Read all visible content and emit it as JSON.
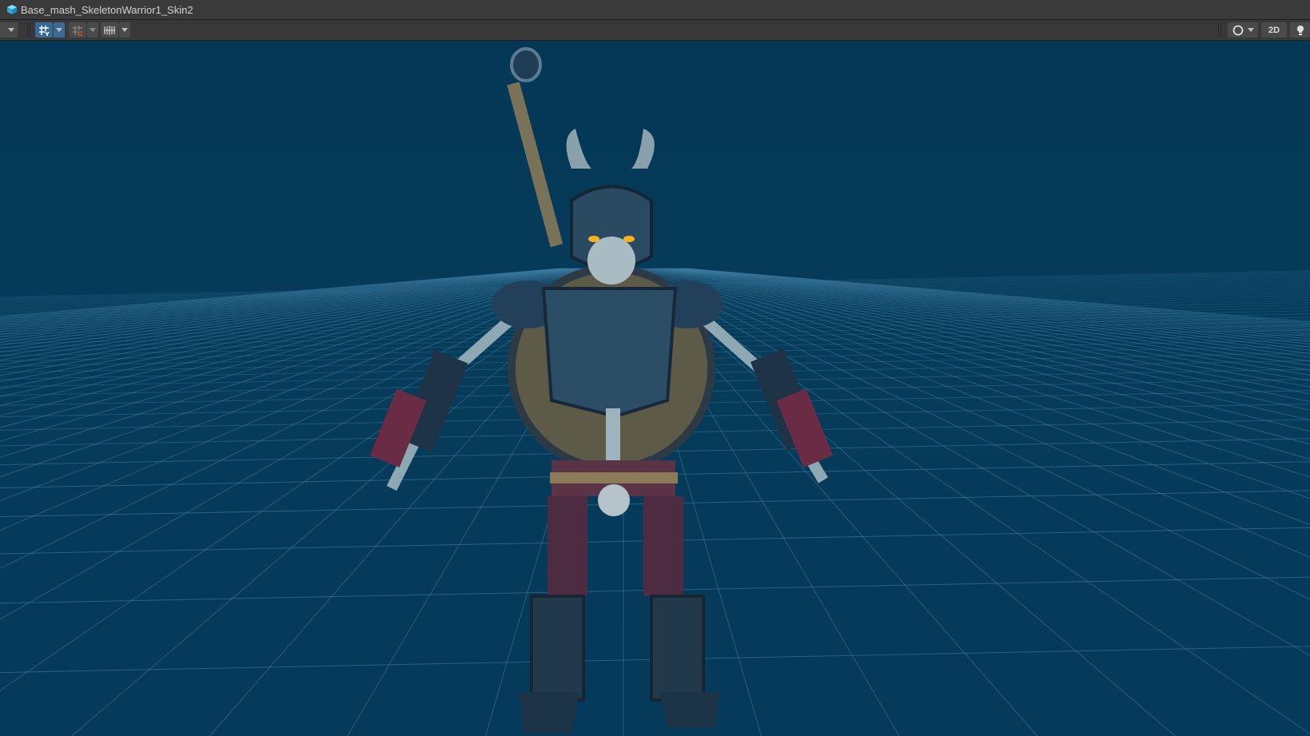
{
  "window": {
    "title": "Base_mash_SkeletonWarrior1_Skin2",
    "icon": "prefab-cube-icon"
  },
  "toolbar": {
    "left_tools": [
      {
        "icon": "transform-tool-icon"
      },
      {
        "icon": "grid-snap-icon",
        "active": true
      },
      {
        "icon": "snap-increment-icon"
      },
      {
        "icon": "grid-visibility-icon"
      }
    ],
    "right_tools": [
      {
        "icon": "shading-mode-icon"
      },
      {
        "label": "2D"
      },
      {
        "icon": "lighting-icon"
      }
    ]
  },
  "colors": {
    "viewport_bg": "#063a58",
    "grid": "#3f7ea3",
    "active_tool": "#3a6a93"
  }
}
